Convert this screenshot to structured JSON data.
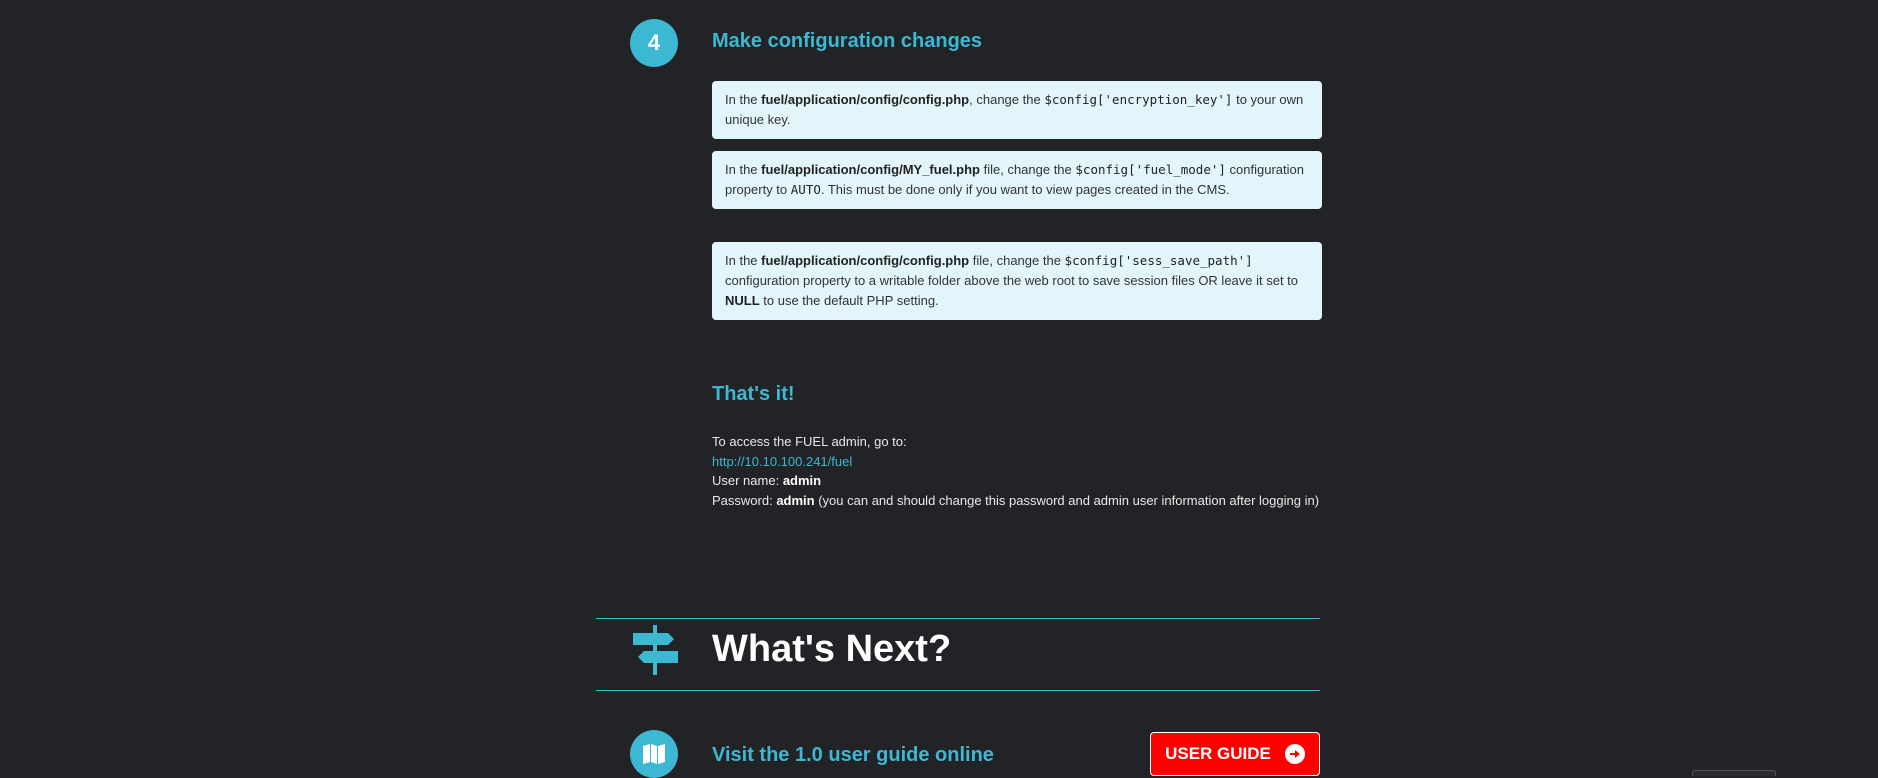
{
  "step4": {
    "number": "4",
    "title": "Make configuration changes",
    "notes": [
      {
        "pre": "In the ",
        "file": "fuel/application/config/config.php",
        "mid": ", change the ",
        "code": "$config['encryption_key']",
        "post": " to your own unique key."
      },
      {
        "pre": "In the ",
        "file": "fuel/application/config/MY_fuel.php",
        "mid": " file, change the ",
        "code": "$config['fuel_mode']",
        "post_a": " configuration property to ",
        "code2": "AUTO",
        "post_b": ". This must be done only if you want to view pages created in the CMS."
      },
      {
        "pre": "In the ",
        "file": "fuel/application/config/config.php",
        "mid": " file, change the ",
        "code": "$config['sess_save_path']",
        "post_a": " configuration property to a writable folder above the web root to save session files OR leave it set to ",
        "bold2": "NULL",
        "post_b": " to use the default PHP setting."
      }
    ]
  },
  "thats_it": {
    "title": "That's it!",
    "intro": "To access the FUEL admin, go to:",
    "url": "http://10.10.100.241/fuel",
    "username_label": "User name: ",
    "username": "admin",
    "password_label": "Password: ",
    "password": "admin",
    "password_note": " (you can and should change this password and admin user information after logging in)"
  },
  "whats_next": {
    "title": "What's Next?",
    "icon": "signpost-icon"
  },
  "user_guide": {
    "icon": "map-icon",
    "title": "Visit the 1.0 user guide online",
    "button_label": "USER GUIDE",
    "button_icon": "arrow-right-circle-icon"
  },
  "colors": {
    "background": "#222326",
    "accent": "#3cb8d3",
    "note_bg": "#e2f5fa",
    "button_red": "#ff0000"
  }
}
